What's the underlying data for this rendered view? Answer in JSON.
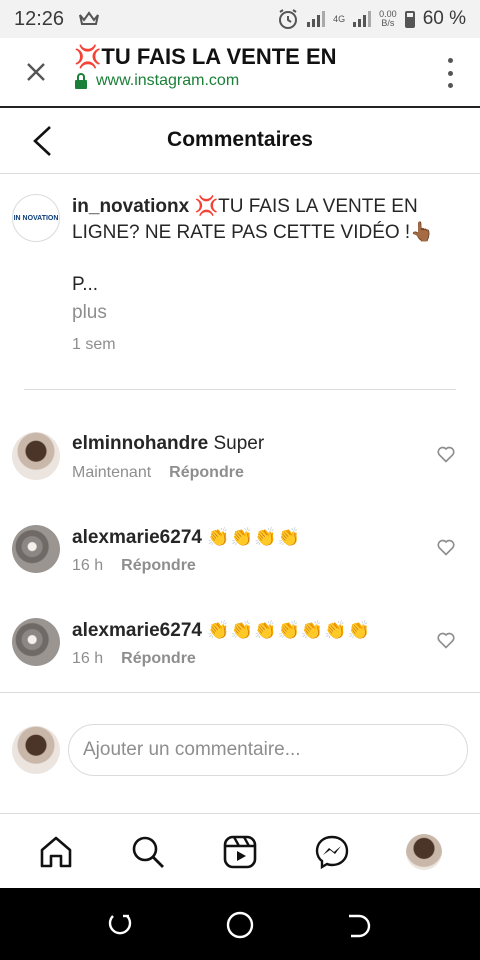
{
  "status_bar": {
    "time": "12:26",
    "net_type": "4G",
    "speed_value": "0.00",
    "speed_unit": "B/s",
    "battery": "60 %",
    "icons": [
      "crown-icon",
      "alarm-icon",
      "signal-icon",
      "battery-icon"
    ]
  },
  "browser": {
    "close_icon": "close-icon",
    "title_emoji": "💢",
    "title": "TU FAIS LA VENTE EN",
    "url": "www.instagram.com",
    "lock_icon": "lock-icon",
    "menu_icon": "more-vertical-icon"
  },
  "header": {
    "title": "Commentaires",
    "back_icon": "chevron-left-icon"
  },
  "post": {
    "avatar_text": "IN NOVATION",
    "username": "in_novationx",
    "caption_emoji": "💢",
    "caption": "TU FAIS LA VENTE EN LIGNE? NE RATE PAS CETTE VIDÉO !",
    "caption_end_emoji": "👆🏾",
    "caption_more": "P...",
    "more_label": "plus",
    "time": "1 sem"
  },
  "comments": [
    {
      "username": "elminnohandre",
      "text": "Super",
      "time": "Maintenant",
      "reply_label": "Répondre"
    },
    {
      "username": "alexmarie6274",
      "text": "👏👏👏👏",
      "time": "16 h",
      "reply_label": "Répondre"
    },
    {
      "username": "alexmarie6274",
      "text": "👏👏👏👏👏👏👏",
      "time": "16 h",
      "reply_label": "Répondre"
    }
  ],
  "composer": {
    "placeholder": "Ajouter un commentaire..."
  },
  "bottom_nav": {
    "items": [
      "home-icon",
      "search-icon",
      "reels-icon",
      "messenger-icon",
      "profile-avatar"
    ]
  },
  "colors": {
    "text": "#262626",
    "secondary": "#8e8e8e",
    "link_green": "#1a7f37",
    "divider": "#dbdbdb"
  }
}
